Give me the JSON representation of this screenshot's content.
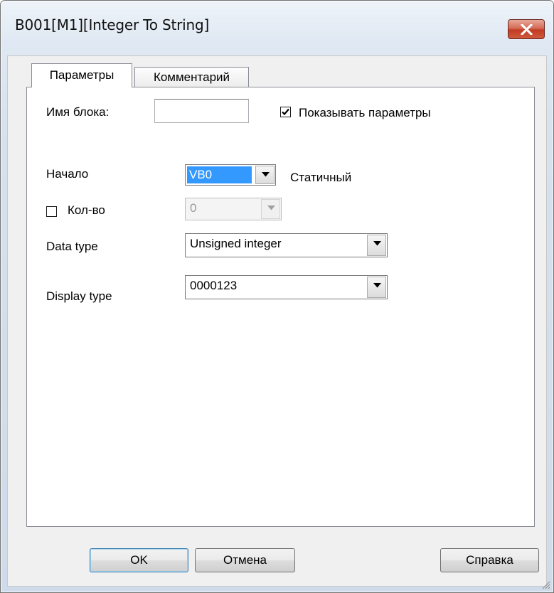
{
  "window": {
    "title": "B001[M1][Integer To String]"
  },
  "tabs": [
    {
      "label": "Параметры",
      "active": true
    },
    {
      "label": "Комментарий",
      "active": false
    }
  ],
  "form": {
    "block_name": {
      "label": "Имя блока:",
      "value": ""
    },
    "show_params": {
      "label": "Показывать параметры",
      "checked": true
    },
    "start": {
      "label": "Начало",
      "value": "VB0",
      "mode_label": "Статичный"
    },
    "count": {
      "label": "Кол-во",
      "checked": false,
      "value": "0"
    },
    "data_type": {
      "label": "Data type",
      "value": "Unsigned integer"
    },
    "display_type": {
      "label": "Display type",
      "value": "0000123"
    }
  },
  "buttons": {
    "ok": "OK",
    "cancel": "Отмена",
    "help": "Справка"
  },
  "colors": {
    "selection": "#3399ff",
    "close_button": "#c74a33"
  }
}
